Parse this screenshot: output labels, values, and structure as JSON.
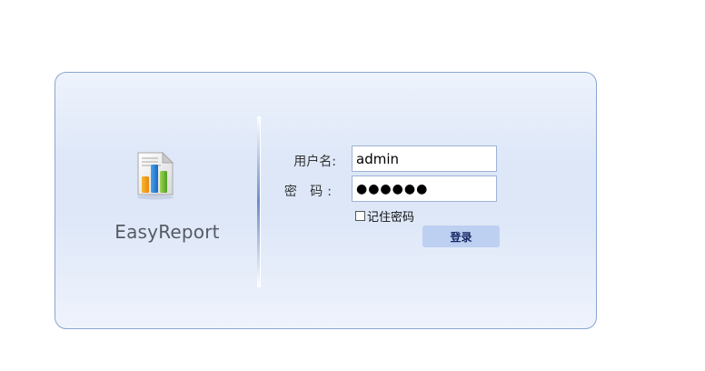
{
  "app": {
    "name": "EasyReport",
    "icon": "report-chart-icon"
  },
  "form": {
    "username_label": "用户名:",
    "password_label": "密 码:",
    "username_value": "admin",
    "password_value": "●●●●●●",
    "remember_label": "记住密码",
    "remember_checked": false,
    "login_button_label": "登录"
  },
  "colors": {
    "panel_border": "#8aa6d2",
    "panel_background": "#dde7f8",
    "button_background": "#bdd0f2",
    "button_text": "#1a2a66"
  }
}
